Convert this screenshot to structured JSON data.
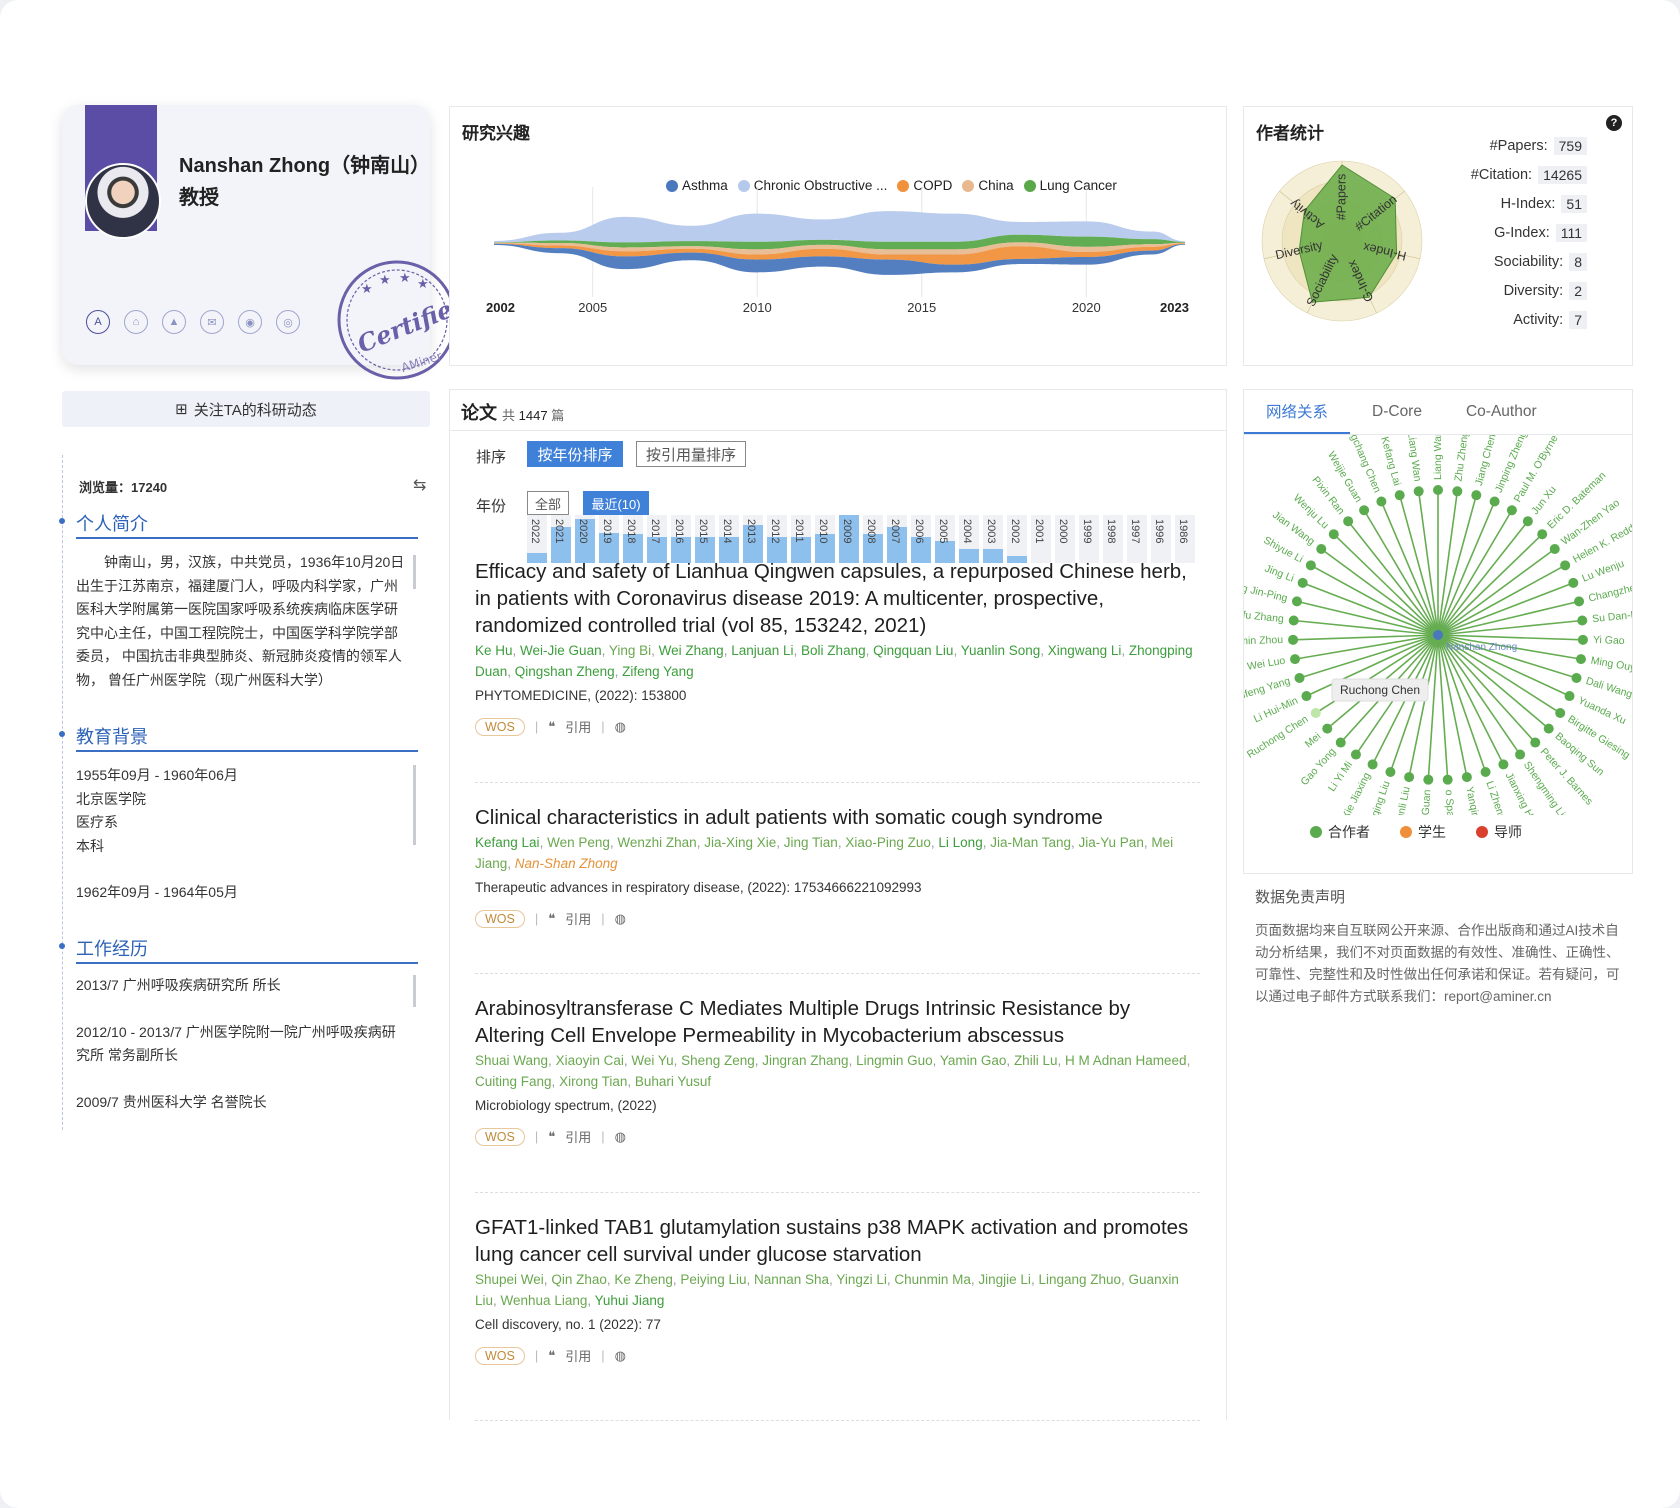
{
  "profile": {
    "name": "Nanshan Zhong（钟南山）",
    "title": "教授",
    "stamp_text": "Certified",
    "stamp_sub": "AMiner",
    "follow_label": "关注TA的科研动态"
  },
  "info": {
    "views_label": "浏览量：17240",
    "bio_title": "个人简介",
    "bio": "　　钟南山，男，汉族，中共党员，1936年10月20日 出生于江苏南京，福建厦门人，呼吸内科学家，广州医科大学附属第一医院国家呼吸系统疾病临床医学研究中心主任，中国工程院院士，中国医学科学院学部委员， 中国抗击非典型肺炎、新冠肺炎疫情的领军人物， 曾任广州医学院（现广州医科大学）",
    "edu_title": "教育背景",
    "edu": [
      "1955年09月 - 1960年06月",
      "北京医学院",
      "医疗系",
      "本科",
      "",
      "1962年09月 - 1964年05月"
    ],
    "work_title": "工作经历",
    "work": [
      "2013/7 广州呼吸疾病研究所 所长",
      "2012/10 - 2013/7 广州医学院附一院广州呼吸疾病研究所 常务副所长",
      "2009/7 贵州医科大学 名誉院长"
    ]
  },
  "research": {
    "title": "研究兴趣",
    "legend": [
      {
        "name": "Asthma",
        "color": "#4a78bd"
      },
      {
        "name": "Chronic Obstructive ...",
        "color": "#b5c9ec"
      },
      {
        "name": "COPD",
        "color": "#f0913c"
      },
      {
        "name": "China",
        "color": "#e8b98f"
      },
      {
        "name": "Lung Cancer",
        "color": "#5aa84a"
      }
    ],
    "axis_start": "2002",
    "axis_end": "2023",
    "ticks": [
      "2005",
      "2010",
      "2015",
      "2020"
    ]
  },
  "chart_data": {
    "type": "area",
    "title": "研究兴趣",
    "x": [
      2002,
      2004,
      2006,
      2008,
      2010,
      2012,
      2014,
      2016,
      2018,
      2020,
      2022,
      2023
    ],
    "xlim": [
      2002,
      2023
    ],
    "series": [
      {
        "name": "Asthma",
        "values": [
          0.5,
          2,
          5,
          3,
          5,
          4,
          6,
          3,
          2,
          3,
          1.5,
          0.3
        ]
      },
      {
        "name": "Chronic Obstructive ...",
        "values": [
          0.5,
          3,
          10,
          6,
          11,
          8,
          12,
          11,
          5,
          6,
          3,
          0.3
        ]
      },
      {
        "name": "COPD",
        "values": [
          0.2,
          1,
          2,
          1.5,
          2,
          3,
          2,
          4,
          5,
          2,
          1.5,
          0.3
        ]
      },
      {
        "name": "China",
        "values": [
          0.2,
          1,
          1.5,
          1,
          2,
          1.5,
          2,
          2,
          1.5,
          2,
          1,
          0.2
        ]
      },
      {
        "name": "Lung Cancer",
        "values": [
          0.2,
          1,
          2,
          2,
          3,
          2,
          3,
          3,
          3,
          4,
          2,
          0.3
        ]
      }
    ],
    "legend_position": "top"
  },
  "stats": {
    "title": "作者统计",
    "help": "?",
    "rows": [
      {
        "label": "#Papers:",
        "value": "759"
      },
      {
        "label": "#Citation:",
        "value": "14265"
      },
      {
        "label": "H-Index:",
        "value": "51"
      },
      {
        "label": "G-Index:",
        "value": "111"
      },
      {
        "label": "Sociability:",
        "value": "8"
      },
      {
        "label": "Diversity:",
        "value": "2"
      },
      {
        "label": "Activity:",
        "value": "7"
      }
    ],
    "radar_axes": [
      "#Papers",
      "#Citation",
      "H-Index",
      "G-Index",
      "Sociability",
      "Diversity",
      "Activity"
    ]
  },
  "papers": {
    "title": "论文",
    "count_prefix": "共",
    "count": "1447",
    "count_suffix": "篇",
    "sort_label": "排序",
    "sort_year": "按年份排序",
    "sort_cite": "按引用量排序",
    "year_label": "年份",
    "year_all": "全部",
    "year_recent": "最近(10)",
    "years": [
      {
        "y": "2022",
        "v": 0.2
      },
      {
        "y": "2021",
        "v": 0.75
      },
      {
        "y": "2020",
        "v": 0.92
      },
      {
        "y": "2019",
        "v": 0.62
      },
      {
        "y": "2018",
        "v": 0.6
      },
      {
        "y": "2017",
        "v": 0.55
      },
      {
        "y": "2016",
        "v": 0.55
      },
      {
        "y": "2015",
        "v": 0.55
      },
      {
        "y": "2014",
        "v": 0.55
      },
      {
        "y": "2013",
        "v": 0.8
      },
      {
        "y": "2012",
        "v": 0.55
      },
      {
        "y": "2011",
        "v": 0.55
      },
      {
        "y": "2010",
        "v": 0.6
      },
      {
        "y": "2009",
        "v": 1.0
      },
      {
        "y": "2008",
        "v": 0.6
      },
      {
        "y": "2007",
        "v": 0.75
      },
      {
        "y": "2006",
        "v": 0.55
      },
      {
        "y": "2005",
        "v": 0.45
      },
      {
        "y": "2004",
        "v": 0.3
      },
      {
        "y": "2003",
        "v": 0.3
      },
      {
        "y": "2002",
        "v": 0.15
      },
      {
        "y": "2001",
        "v": 0
      },
      {
        "y": "2000",
        "v": 0
      },
      {
        "y": "1999",
        "v": 0
      },
      {
        "y": "1998",
        "v": 0
      },
      {
        "y": "1997",
        "v": 0
      },
      {
        "y": "1996",
        "v": 0
      },
      {
        "y": "1986",
        "v": 0
      }
    ],
    "tag_wos": "WOS",
    "tag_cite": "引用",
    "items": [
      {
        "title": "Efficacy and safety of Lianhua Qingwen capsules, a repurposed Chinese herb, in patients with Coronavirus disease 2019: A multicenter, prospective, randomized controlled trial (vol 85, 153242, 2021)",
        "authors": [
          {
            "n": "Ke Hu",
            "s": "g"
          },
          {
            "n": "Wei-Jie Guan",
            "s": "g"
          },
          {
            "n": "Ying Bi",
            "s": "l"
          },
          {
            "n": "Wei Zhang",
            "s": "g"
          },
          {
            "n": "Lanjuan Li",
            "s": "g"
          },
          {
            "n": "Boli Zhang",
            "s": "g"
          },
          {
            "n": "Qingquan Liu",
            "s": "g"
          },
          {
            "n": "Yuanlin Song",
            "s": "g"
          },
          {
            "n": "Xingwang Li",
            "s": "g"
          },
          {
            "n": "Zhongping Duan",
            "s": "g"
          },
          {
            "n": "Qingshan Zheng",
            "s": "g"
          },
          {
            "n": "Zifeng Yang",
            "s": "g"
          }
        ],
        "venue": "PHYTOMEDICINE, (2022): 153800"
      },
      {
        "title": "Clinical characteristics in adult patients with somatic cough syndrome",
        "authors": [
          {
            "n": "Kefang Lai",
            "s": "g"
          },
          {
            "n": "Wen Peng",
            "s": "l"
          },
          {
            "n": "Wenzhi Zhan",
            "s": "l"
          },
          {
            "n": "Jia-Xing Xie",
            "s": "l"
          },
          {
            "n": "Jing Tian",
            "s": "l"
          },
          {
            "n": "Xiao-Ping Zuo",
            "s": "l"
          },
          {
            "n": "Li Long",
            "s": "g"
          },
          {
            "n": "Jia-Man Tang",
            "s": "l"
          },
          {
            "n": "Jia-Yu Pan",
            "s": "l"
          },
          {
            "n": "Mei Jiang",
            "s": "l"
          },
          {
            "n": "Nan-Shan Zhong",
            "s": "o"
          }
        ],
        "venue": "Therapeutic advances in respiratory disease, (2022): 17534666221092993"
      },
      {
        "title": "Arabinosyltransferase C Mediates Multiple Drugs Intrinsic Resistance by Altering Cell Envelope Permeability in Mycobacterium abscessus",
        "authors": [
          {
            "n": "Shuai Wang",
            "s": "l"
          },
          {
            "n": "Xiaoyin Cai",
            "s": "l"
          },
          {
            "n": "Wei Yu",
            "s": "l"
          },
          {
            "n": "Sheng Zeng",
            "s": "l"
          },
          {
            "n": "Jingran Zhang",
            "s": "l"
          },
          {
            "n": "Lingmin Guo",
            "s": "l"
          },
          {
            "n": "Yamin Gao",
            "s": "l"
          },
          {
            "n": "Zhili Lu",
            "s": "l"
          },
          {
            "n": "H M Adnan Hameed",
            "s": "l"
          },
          {
            "n": "Cuiting Fang",
            "s": "l"
          },
          {
            "n": "Xirong Tian",
            "s": "l"
          },
          {
            "n": "Buhari Yusuf",
            "s": "l"
          }
        ],
        "venue": "Microbiology spectrum, (2022)"
      },
      {
        "title": "GFAT1-linked TAB1 glutamylation sustains p38 MAPK activation and promotes lung cancer cell survival under glucose starvation",
        "authors": [
          {
            "n": "Shupei Wei",
            "s": "l"
          },
          {
            "n": "Qin Zhao",
            "s": "l"
          },
          {
            "n": "Ke Zheng",
            "s": "l"
          },
          {
            "n": "Peiying Liu",
            "s": "l"
          },
          {
            "n": "Nannan Sha",
            "s": "l"
          },
          {
            "n": "Yingzi Li",
            "s": "l"
          },
          {
            "n": "Chunmin Ma",
            "s": "l"
          },
          {
            "n": "Jingjie Li",
            "s": "l"
          },
          {
            "n": "Lingang Zhuo",
            "s": "l"
          },
          {
            "n": "Guanxin Liu",
            "s": "l"
          },
          {
            "n": "Wenhua Liang",
            "s": "l"
          },
          {
            "n": "Yuhui Jiang",
            "s": "g"
          }
        ],
        "venue": "Cell discovery, no. 1 (2022): 77"
      }
    ]
  },
  "network": {
    "tabs": [
      "网络关系",
      "D-Core",
      "Co-Author"
    ],
    "center": "Nanshan Zhong",
    "tooltip": "Ruchong Chen",
    "nodes": [
      "Liang Wan",
      "Zhu Zheng",
      "Jiang Chen",
      "Jinping Zheng",
      "Paul M. O'Byrne",
      "Jun Xu",
      "Eric D. Bateman",
      "Wan-Zhen Yao",
      "Helen K. Redde",
      "Lu Wenju",
      "Changzheng",
      "Su Dan-Hon",
      "Yi Gao",
      "Ming Ouyan",
      "Dali Wang",
      "Yuanda Xu",
      "Birgitte Giesing",
      "Baoqing Sun",
      "Peter J. Barnes",
      "Shengming Liu",
      "Jianxing He",
      "Li Zheng-tu",
      "Yanqing Xie",
      "o Spangfort",
      "Wenda Guan",
      "Chunli Liu",
      "Xiaoqing Liu",
      "Xie Jiaxing",
      "Li Yi Mi",
      "Gao Yong",
      "Mei",
      "Ruchong Chen",
      "Li Hui-Min",
      "Zifeng Yang",
      "Wei Luo",
      "Yumin Zhou",
      "Nuofu Zhang",
      "Zheng Jin-Ping",
      "Jing Li",
      "Shiyue Li",
      "Jian Wang",
      "Wenju Lu",
      "Pixin Ran",
      "Weijie Guan",
      "Rongchang Chen",
      "Kefang Lai",
      "Liang Wan"
    ],
    "legend": [
      {
        "name": "合作者",
        "color": "#5aaa4e"
      },
      {
        "name": "学生",
        "color": "#ef8f3a"
      },
      {
        "name": "导师",
        "color": "#d9412e"
      }
    ]
  },
  "disclaimer": {
    "title": "数据免责声明",
    "body": "页面数据均来自互联网公开来源、合作出版商和通过AI技术自动分析结果，我们不对页面数据的有效性、准确性、正确性、可靠性、完整性和及时性做出任何承诺和保证。若有疑问，可以通过电子邮件方式联系我们：report@aminer.cn"
  }
}
